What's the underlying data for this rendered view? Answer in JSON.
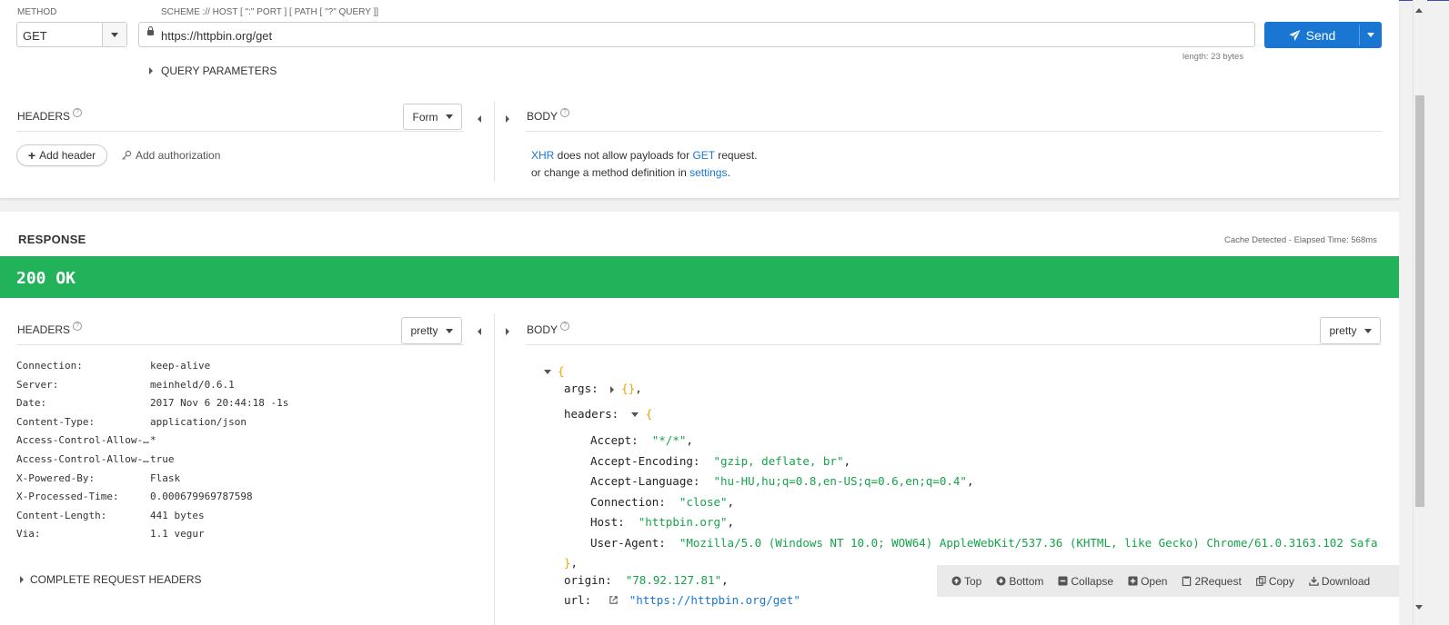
{
  "request": {
    "method_label": "METHOD",
    "url_label": "SCHEME :// HOST [ \":\" PORT ] [ PATH [ \"?\" QUERY ]]",
    "method": "GET",
    "url": "https://httpbin.org/get",
    "send_label": "Send",
    "length": "length: 23 bytes",
    "query_params_label": "QUERY PARAMETERS",
    "headers_title": "HEADERS",
    "form_label": "Form",
    "add_header_label": "Add header",
    "add_auth_label": "Add authorization",
    "body_title": "BODY",
    "body_msg": {
      "xhr": "XHR",
      "part1": " does not allow payloads for ",
      "get": "GET",
      "part2": " request.",
      "line2": "or change a method definition in ",
      "settings": "settings",
      "dot": "."
    }
  },
  "response": {
    "title": "RESPONSE",
    "cache_info": "Cache Detected - Elapsed Time: 568ms",
    "status": "200 OK",
    "status_color": "#22b35a",
    "headers_title": "HEADERS",
    "headers_format": "pretty",
    "body_title": "BODY",
    "body_format": "pretty",
    "headers": [
      {
        "name": "Connection:",
        "value": "keep-alive"
      },
      {
        "name": "Server:",
        "value": "meinheld/0.6.1"
      },
      {
        "name": "Date:",
        "value": "2017 Nov 6 20:44:18 -1s"
      },
      {
        "name": "Content-Type:",
        "value": "application/json"
      },
      {
        "name": "Access-Control-Allow-…",
        "value": "*"
      },
      {
        "name": "Access-Control-Allow-…",
        "value": "true"
      },
      {
        "name": "X-Powered-By:",
        "value": "Flask"
      },
      {
        "name": "X-Processed-Time:",
        "value": "0.000679969787598"
      },
      {
        "name": "Content-Length:",
        "value": "441 bytes"
      },
      {
        "name": "Via:",
        "value": "1.1 vegur"
      }
    ],
    "complete_request_headers": "COMPLETE REQUEST HEADERS",
    "json": {
      "args_key": "args:",
      "args_val": "{}",
      "headers_key": "headers:",
      "headers": [
        {
          "key": "Accept:",
          "value": "\"*/*\""
        },
        {
          "key": "Accept-Encoding:",
          "value": "\"gzip, deflate, br\""
        },
        {
          "key": "Accept-Language:",
          "value": "\"hu-HU,hu;q=0.8,en-US;q=0.6,en;q=0.4\""
        },
        {
          "key": "Connection:",
          "value": "\"close\""
        },
        {
          "key": "Host:",
          "value": "\"httpbin.org\""
        },
        {
          "key": "User-Agent:",
          "value": "\"Mozilla/5.0 (Windows NT 10.0; WOW64) AppleWebKit/537.36 (KHTML, like Gecko) Chrome/61.0.3163.102 Safa"
        }
      ],
      "origin_key": "origin:",
      "origin_val": "\"78.92.127.81\"",
      "url_key": "url:",
      "url_val": "\"https://httpbin.org/get\""
    },
    "toolbar": {
      "top": "Top",
      "bottom": "Bottom",
      "collapse": "Collapse",
      "open": "Open",
      "to_request": "2Request",
      "copy": "Copy",
      "download": "Download"
    }
  }
}
